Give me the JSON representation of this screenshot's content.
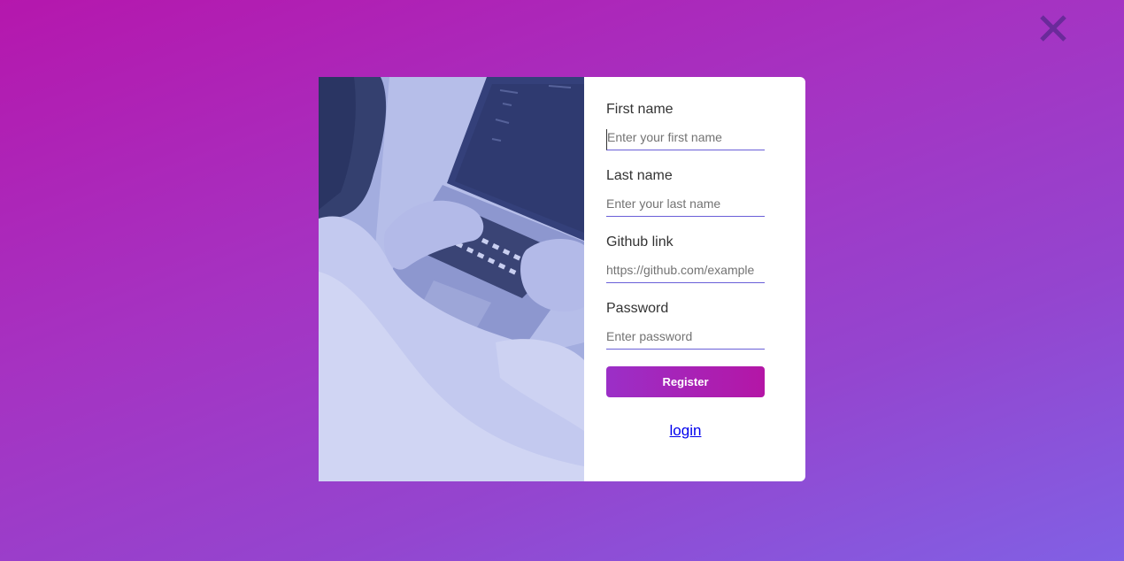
{
  "icons": {
    "close": "close-icon"
  },
  "colors": {
    "background_start": "#b517ad",
    "background_end": "#8160e4",
    "input_underline": "#6a5fd8",
    "button_start": "#9b2fc7",
    "button_end": "#b416a6",
    "link": "#0000ee"
  },
  "form": {
    "fields": [
      {
        "label": "First name",
        "placeholder": "Enter your first name",
        "value": ""
      },
      {
        "label": "Last name",
        "placeholder": "Enter your last name",
        "value": ""
      },
      {
        "label": "Github link",
        "placeholder": "https://github.com/example",
        "value": ""
      },
      {
        "label": "Password",
        "placeholder": "Enter password",
        "value": ""
      }
    ],
    "register_label": "Register",
    "login_label": "login"
  }
}
